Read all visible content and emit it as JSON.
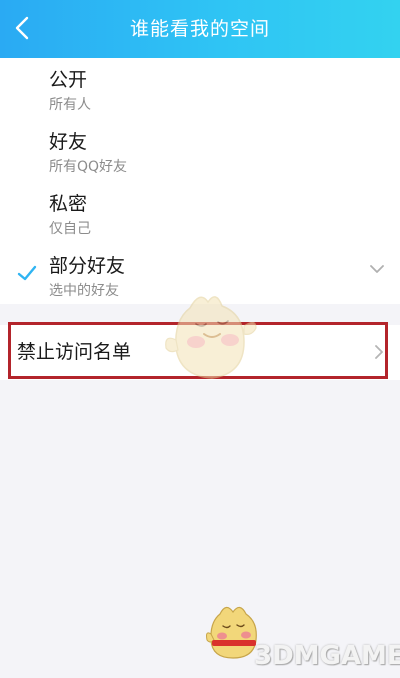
{
  "header": {
    "title": "谁能看我的空间",
    "back_icon": "chevron-left-icon"
  },
  "options": [
    {
      "title": "公开",
      "subtitle": "所有人",
      "selected": false
    },
    {
      "title": "好友",
      "subtitle": "所有QQ好友",
      "selected": false
    },
    {
      "title": "私密",
      "subtitle": "仅自己",
      "selected": false
    },
    {
      "title": "部分好友",
      "subtitle": "选中的好友",
      "selected": true,
      "expand_icon": "chevron-down-icon"
    }
  ],
  "blocklist": {
    "label": "禁止访问名单",
    "chevron_icon": "chevron-right-icon"
  },
  "watermark": {
    "text": "3DMGAME"
  },
  "colors": {
    "header_start": "#2aaaf3",
    "header_end": "#33d2f0",
    "check": "#2fb4f2",
    "highlight": "#b3242b",
    "background": "#f4f4f8"
  }
}
